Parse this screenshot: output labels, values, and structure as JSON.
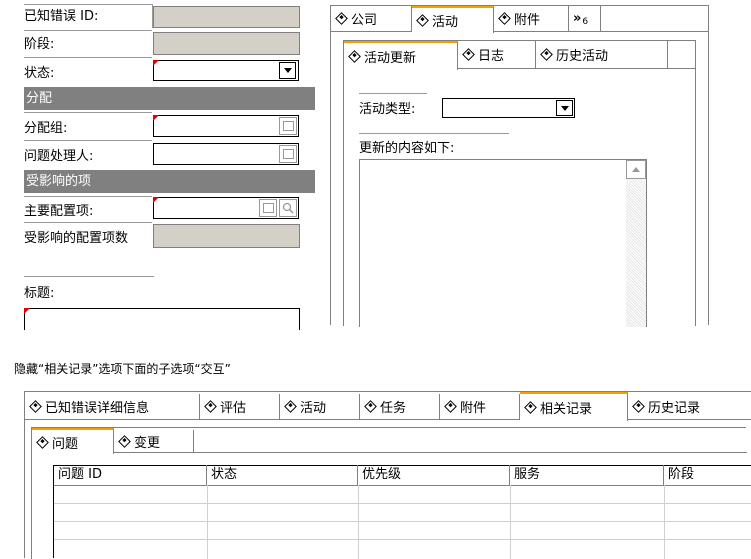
{
  "top_form": {
    "known_error_id_label": "已知错误 ID:",
    "stage_label": "阶段:",
    "status_label": "状态:",
    "assignment_section": "分配",
    "assignment_group_label": "分配组:",
    "problem_handler_label": "问题处理人:",
    "affected_items_section": "受影响的项",
    "main_ci_label": "主要配置项:",
    "affected_ci_count_label": "受影响的配置项数",
    "title_label": "标题:"
  },
  "right_panel": {
    "tabs": [
      "公司",
      "活动",
      "附件"
    ],
    "overflow_label": "»",
    "overflow_count": "6",
    "subtabs": [
      "活动更新",
      "日志",
      "历史活动"
    ],
    "activity_type_label": "活动类型:",
    "update_content_label": "更新的内容如下:"
  },
  "instruction": "隐藏“相关记录”选项下面的子选项“交互”",
  "bottom_panel": {
    "tabs": [
      "已知错误详细信息",
      "评估",
      "活动",
      "任务",
      "附件",
      "相关记录",
      "历史记录"
    ],
    "subtabs": [
      "问题",
      "变更"
    ],
    "columns": [
      "问题 ID",
      "状态",
      "优先级",
      "服务",
      "阶段"
    ]
  },
  "colors": {
    "active_tab_accent": "#f5a000",
    "required_marker": "#e00000",
    "section_band": "#808080"
  }
}
